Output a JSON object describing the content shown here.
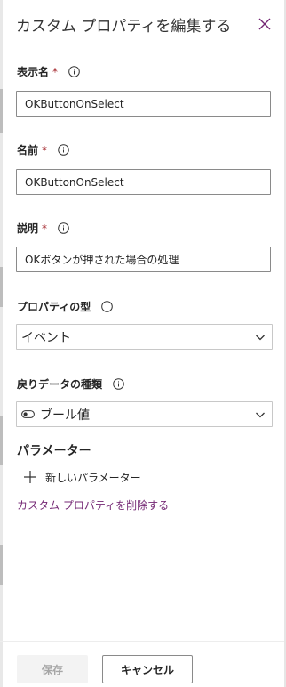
{
  "panel": {
    "title": "カスタム プロパティを編集する"
  },
  "fields": {
    "display_name": {
      "label": "表示名",
      "required_mark": "*",
      "value": "OKButtonOnSelect"
    },
    "name": {
      "label": "名前",
      "required_mark": "*",
      "value": "OKButtonOnSelect"
    },
    "description": {
      "label": "説明",
      "required_mark": "*",
      "value": "OKボタンが押された場合の処理"
    },
    "property_type": {
      "label": "プロパティの型",
      "selected": "イベント"
    },
    "return_type": {
      "label": "戻りデータの種類",
      "selected": "ブール値"
    }
  },
  "parameters": {
    "heading": "パラメーター",
    "add_label": "新しいパラメーター"
  },
  "delete_link": "カスタム プロパティを削除する",
  "footer": {
    "save_label": "保存",
    "cancel_label": "キャンセル"
  },
  "colors": {
    "required": "#a4262c",
    "link": "#742774",
    "border": "#8a8a8a"
  },
  "icons": {
    "close": "close-icon",
    "info": "info-icon",
    "chevron": "chevron-down-icon",
    "toggle": "toggle-icon",
    "add": "plus-icon"
  }
}
